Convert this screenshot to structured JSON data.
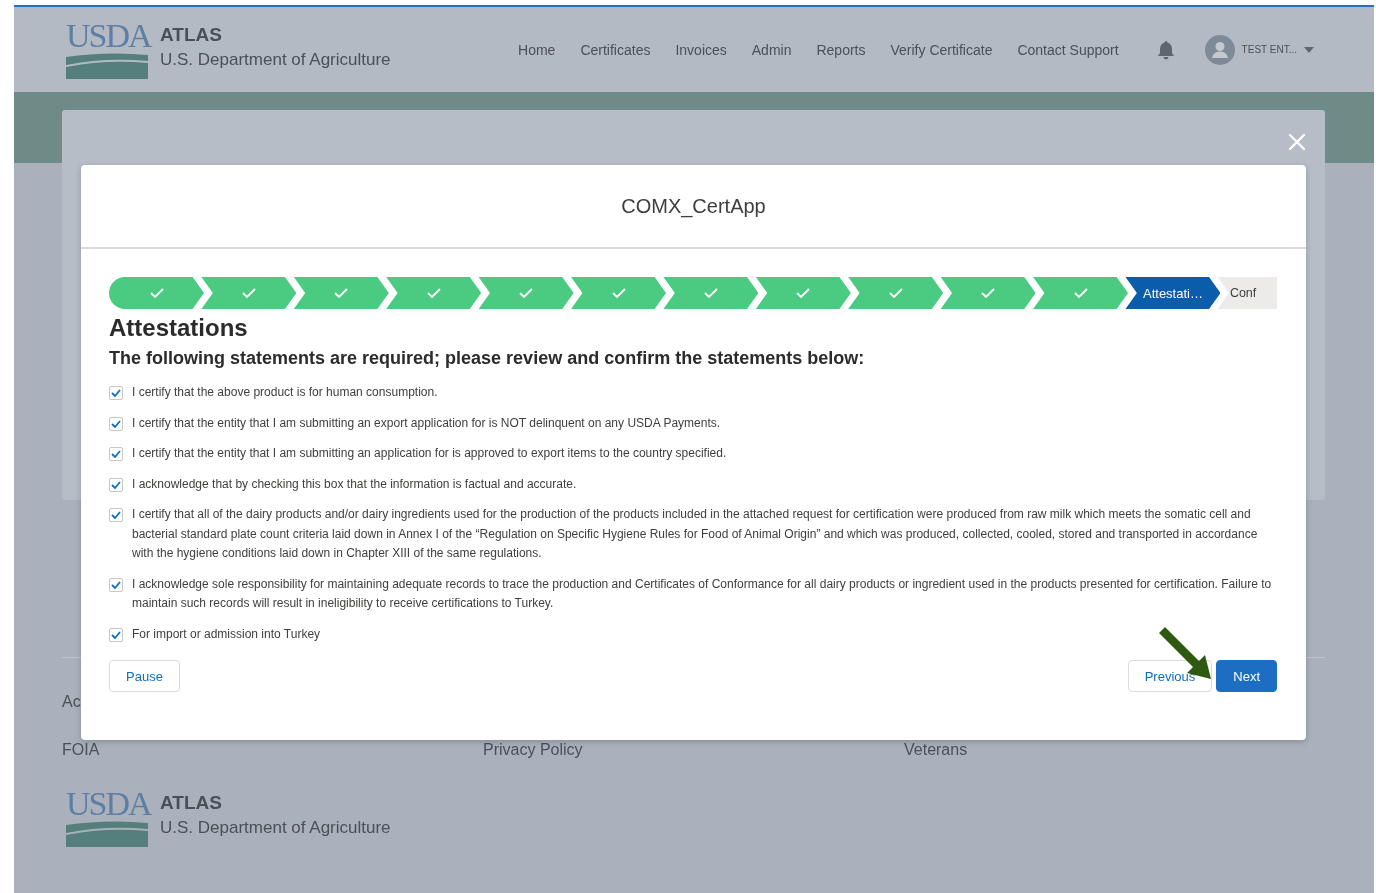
{
  "header": {
    "logo": {
      "mark": "USDA",
      "name": "ATLAS",
      "subtitle": "U.S. Department of Agriculture"
    },
    "nav": [
      "Home",
      "Certificates",
      "Invoices",
      "Admin",
      "Reports",
      "Verify Certificate",
      "Contact Support"
    ],
    "user": {
      "name": "TEST ENT..."
    }
  },
  "footer": {
    "rows": [
      [
        "Ac"
      ],
      [
        "FOIA",
        "Privacy Policy",
        "Veterans"
      ]
    ],
    "logo": {
      "mark": "USDA",
      "name": "ATLAS",
      "subtitle": "U.S. Department of Agriculture"
    }
  },
  "modal": {
    "title": "COMX_CertApp",
    "path": [
      {
        "complete": true
      },
      {
        "complete": true
      },
      {
        "complete": true
      },
      {
        "complete": true
      },
      {
        "complete": true
      },
      {
        "complete": true
      },
      {
        "complete": true
      },
      {
        "complete": true
      },
      {
        "complete": true
      },
      {
        "complete": true
      },
      {
        "complete": true
      },
      {
        "complete": false,
        "selected": true,
        "label": "Attestati…"
      },
      {
        "complete": false,
        "selected": false,
        "label": "Conf"
      }
    ],
    "heading": "Attestations",
    "subheading": "The following statements are required; please review and confirm the statements below:",
    "statements": [
      {
        "checked": true,
        "text": "I certify that the above product is for human consumption."
      },
      {
        "checked": true,
        "text": "I certify that the entity that I am submitting an export application for is NOT delinquent on any USDA Payments."
      },
      {
        "checked": true,
        "text": "I certify that the entity that I am submitting an application for is approved to export items to the country specified."
      },
      {
        "checked": true,
        "text": "I acknowledge that by checking this box that the information is factual and accurate."
      },
      {
        "checked": true,
        "text": "I certify that all of the dairy products and/or dairy ingredients used for the production of the products included in the attached request for certification were produced from raw milk which meets the somatic cell and bacterial standard plate count criteria laid down in Annex I of the “Regulation on Specific Hygiene Rules for Food of Animal Origin” and which was produced, collected, cooled, stored and transported in accordance with the hygiene conditions laid down in Chapter XIII of the same regulations."
      },
      {
        "checked": true,
        "text": "I acknowledge sole responsibility for maintaining adequate records to trace the production and Certificates of Conformance for all dairy products or ingredient used in the products presented for certification. Failure to maintain such records will result in ineligibility to receive certifications to Turkey."
      },
      {
        "checked": true,
        "text": "For import or admission into Turkey"
      }
    ],
    "buttons": {
      "pause": "Pause",
      "previous": "Previous",
      "next": "Next"
    }
  }
}
